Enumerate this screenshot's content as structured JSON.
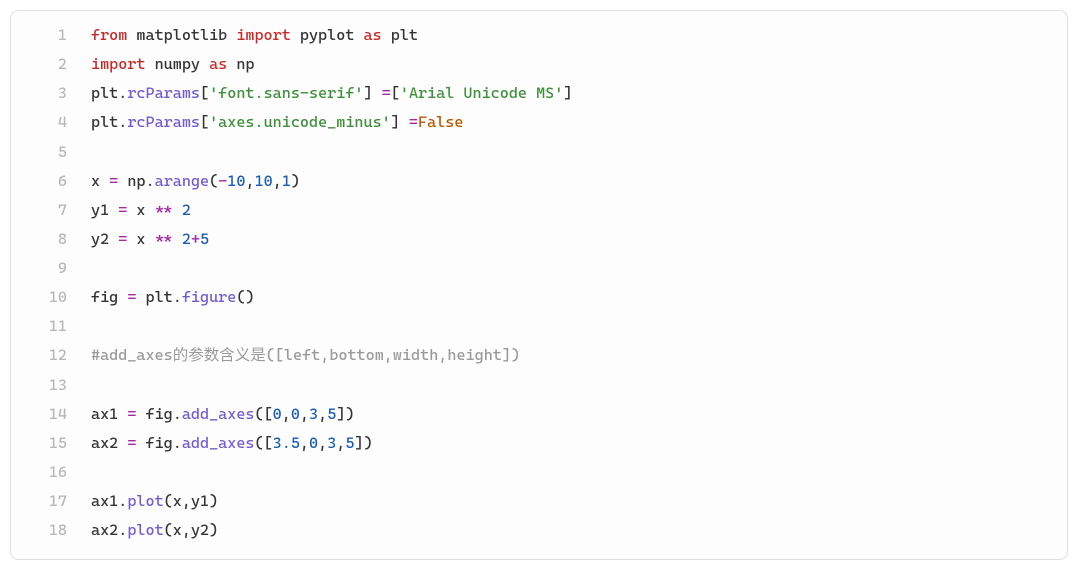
{
  "lines": [
    {
      "n": "1",
      "tokens": [
        [
          "kw",
          "from"
        ],
        [
          "id",
          " matplotlib "
        ],
        [
          "kw",
          "import"
        ],
        [
          "id",
          " pyplot "
        ],
        [
          "kw",
          "as"
        ],
        [
          "id",
          " plt"
        ]
      ]
    },
    {
      "n": "2",
      "tokens": [
        [
          "kw",
          "import"
        ],
        [
          "id",
          " numpy "
        ],
        [
          "kw",
          "as"
        ],
        [
          "id",
          " np"
        ]
      ]
    },
    {
      "n": "3",
      "tokens": [
        [
          "id",
          "plt"
        ],
        [
          "pun",
          "."
        ],
        [
          "fn",
          "rcParams"
        ],
        [
          "pun",
          "["
        ],
        [
          "str",
          "'font.sans-serif'"
        ],
        [
          "pun",
          "] "
        ],
        [
          "op",
          "="
        ],
        [
          "pun",
          "["
        ],
        [
          "str",
          "'Arial Unicode MS'"
        ],
        [
          "pun",
          "]"
        ]
      ]
    },
    {
      "n": "4",
      "tokens": [
        [
          "id",
          "plt"
        ],
        [
          "pun",
          "."
        ],
        [
          "fn",
          "rcParams"
        ],
        [
          "pun",
          "["
        ],
        [
          "str",
          "'axes.unicode_minus'"
        ],
        [
          "pun",
          "] "
        ],
        [
          "op",
          "="
        ],
        [
          "bool",
          "False"
        ]
      ]
    },
    {
      "n": "5",
      "tokens": []
    },
    {
      "n": "6",
      "tokens": [
        [
          "id",
          "x "
        ],
        [
          "op",
          "="
        ],
        [
          "id",
          " np"
        ],
        [
          "pun",
          "."
        ],
        [
          "fn",
          "arange"
        ],
        [
          "pun",
          "("
        ],
        [
          "op",
          "-"
        ],
        [
          "num",
          "10"
        ],
        [
          "pun",
          ","
        ],
        [
          "num",
          "10"
        ],
        [
          "pun",
          ","
        ],
        [
          "num",
          "1"
        ],
        [
          "pun",
          ")"
        ]
      ]
    },
    {
      "n": "7",
      "tokens": [
        [
          "id",
          "y1 "
        ],
        [
          "op",
          "="
        ],
        [
          "id",
          " x "
        ],
        [
          "op",
          "**"
        ],
        [
          "id",
          " "
        ],
        [
          "num",
          "2"
        ]
      ]
    },
    {
      "n": "8",
      "tokens": [
        [
          "id",
          "y2 "
        ],
        [
          "op",
          "="
        ],
        [
          "id",
          " x "
        ],
        [
          "op",
          "**"
        ],
        [
          "id",
          " "
        ],
        [
          "num",
          "2"
        ],
        [
          "op",
          "+"
        ],
        [
          "num",
          "5"
        ]
      ]
    },
    {
      "n": "9",
      "tokens": []
    },
    {
      "n": "10",
      "tokens": [
        [
          "id",
          "fig "
        ],
        [
          "op",
          "="
        ],
        [
          "id",
          " plt"
        ],
        [
          "pun",
          "."
        ],
        [
          "fn",
          "figure"
        ],
        [
          "pun",
          "()"
        ]
      ]
    },
    {
      "n": "11",
      "tokens": []
    },
    {
      "n": "12",
      "tokens": [
        [
          "cmt",
          "#add_axes的参数含义是([left,bottom,width,height])"
        ]
      ]
    },
    {
      "n": "13",
      "tokens": []
    },
    {
      "n": "14",
      "tokens": [
        [
          "id",
          "ax1 "
        ],
        [
          "op",
          "="
        ],
        [
          "id",
          " fig"
        ],
        [
          "pun",
          "."
        ],
        [
          "fn",
          "add_axes"
        ],
        [
          "pun",
          "(["
        ],
        [
          "num",
          "0"
        ],
        [
          "pun",
          ","
        ],
        [
          "num",
          "0"
        ],
        [
          "pun",
          ","
        ],
        [
          "num",
          "3"
        ],
        [
          "pun",
          ","
        ],
        [
          "num",
          "5"
        ],
        [
          "pun",
          "])"
        ]
      ]
    },
    {
      "n": "15",
      "tokens": [
        [
          "id",
          "ax2 "
        ],
        [
          "op",
          "="
        ],
        [
          "id",
          " fig"
        ],
        [
          "pun",
          "."
        ],
        [
          "fn",
          "add_axes"
        ],
        [
          "pun",
          "(["
        ],
        [
          "num",
          "3.5"
        ],
        [
          "pun",
          ","
        ],
        [
          "num",
          "0"
        ],
        [
          "pun",
          ","
        ],
        [
          "num",
          "3"
        ],
        [
          "pun",
          ","
        ],
        [
          "num",
          "5"
        ],
        [
          "pun",
          "])"
        ]
      ]
    },
    {
      "n": "16",
      "tokens": []
    },
    {
      "n": "17",
      "tokens": [
        [
          "id",
          "ax1"
        ],
        [
          "pun",
          "."
        ],
        [
          "fn",
          "plot"
        ],
        [
          "pun",
          "("
        ],
        [
          "id",
          "x"
        ],
        [
          "pun",
          ","
        ],
        [
          "id",
          "y1"
        ],
        [
          "pun",
          ")"
        ]
      ]
    },
    {
      "n": "18",
      "tokens": [
        [
          "id",
          "ax2"
        ],
        [
          "pun",
          "."
        ],
        [
          "fn",
          "plot"
        ],
        [
          "pun",
          "("
        ],
        [
          "id",
          "x"
        ],
        [
          "pun",
          ","
        ],
        [
          "id",
          "y2"
        ],
        [
          "pun",
          ")"
        ]
      ]
    }
  ]
}
